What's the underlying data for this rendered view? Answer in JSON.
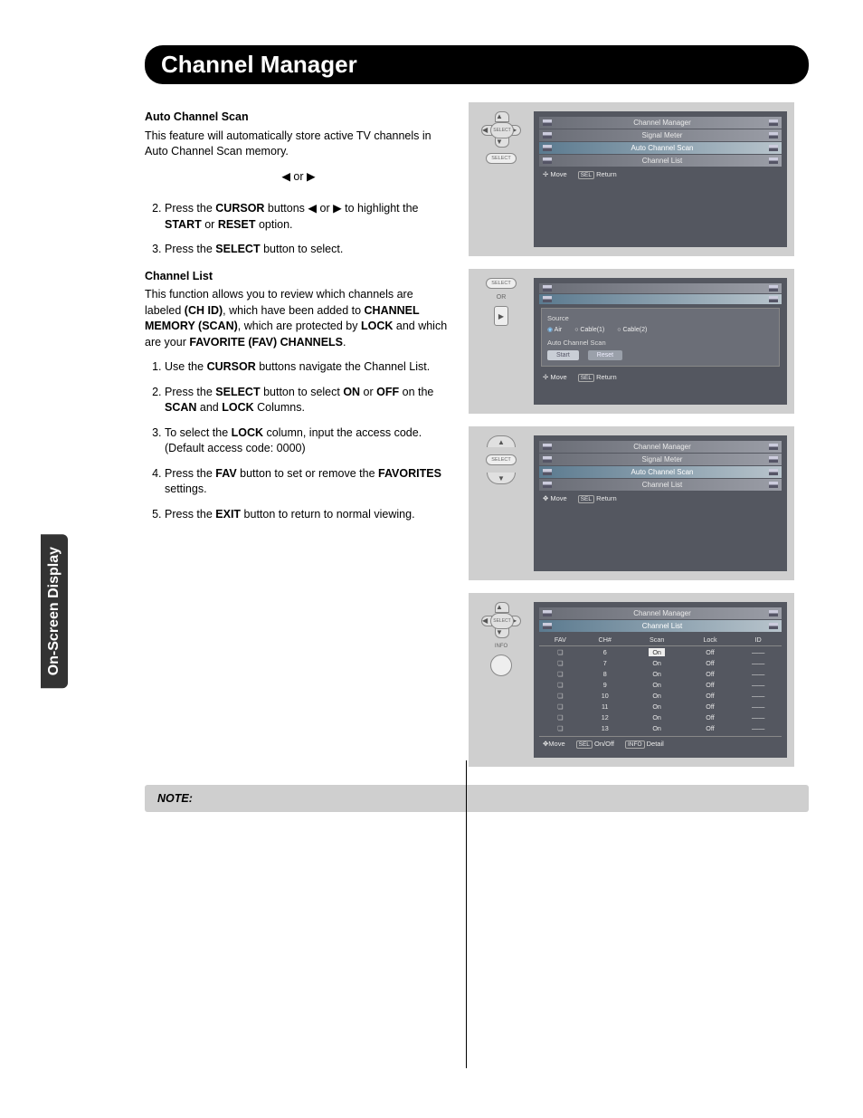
{
  "sideTab": "On-Screen Display",
  "title": "Channel Manager",
  "acs": {
    "heading": "Auto Channel Scan",
    "intro": "This feature will automatically store active TV channels in Auto Channel Scan memory.",
    "orLine": "◀ or ▶",
    "step2_a": "Press the ",
    "step2_b": "CURSOR",
    "step2_c": " buttons ◀ or ▶ to highlight the ",
    "step2_d": "START",
    "step2_e": " or ",
    "step2_f": "RESET",
    "step2_g": " option.",
    "step3_a": "Press the ",
    "step3_b": "SELECT",
    "step3_c": " button to select."
  },
  "cl": {
    "heading": "Channel List",
    "p1_a": "This function allows you to review which channels are labeled ",
    "p1_b": "(CH ID)",
    "p1_c": ", which have been added to ",
    "p1_d": "CHANNEL MEMORY (SCAN)",
    "p1_e": ", which are protected by ",
    "p1_f": "LOCK",
    "p1_g": " and which are your ",
    "p1_h": "FAVORITE (FAV) CHANNELS",
    "p1_i": ".",
    "s1_a": "Use the ",
    "s1_b": "CURSOR",
    "s1_c": " buttons navigate the Channel List.",
    "s2_a": "Press the ",
    "s2_b": "SELECT",
    "s2_c": " button to select ",
    "s2_d": "ON",
    "s2_e": " or ",
    "s2_f": "OFF",
    "s2_g": " on the ",
    "s2_h": "SCAN",
    "s2_i": " and ",
    "s2_j": "LOCK",
    "s2_k": " Columns.",
    "s3_a": "To select the ",
    "s3_b": "LOCK",
    "s3_c": " column, input the access code. (Default access code: 0000)",
    "s4_a": "Press the ",
    "s4_b": "FAV",
    "s4_c": " button to set or remove the ",
    "s4_d": "FAVORITES",
    "s4_e": " settings.",
    "s5_a": "Press the ",
    "s5_b": "EXIT",
    "s5_c": " button to return to normal viewing."
  },
  "note": "NOTE:",
  "osd": {
    "cm": "Channel Manager",
    "sm": "Signal Meter",
    "acs": "Auto Channel Scan",
    "cl": "Channel List",
    "move": "Move",
    "ret": "Return",
    "sel": "SEL",
    "src": "Source",
    "air": "Air",
    "c1": "Cable(1)",
    "c2": "Cable(2)",
    "start": "Start",
    "reset": "Reset",
    "or": "OR",
    "info": "INFO",
    "select": "SELECT",
    "onoff": "On/Off",
    "detail": "Detail",
    "infoK": "INFO"
  },
  "table": {
    "h_fav": "FAV",
    "h_ch": "CH#",
    "h_scan": "Scan",
    "h_lock": "Lock",
    "h_id": "ID",
    "rows": [
      {
        "ch": "6",
        "scan": "On",
        "lock": "Off",
        "id": "——"
      },
      {
        "ch": "7",
        "scan": "On",
        "lock": "Off",
        "id": "——"
      },
      {
        "ch": "8",
        "scan": "On",
        "lock": "Off",
        "id": "——"
      },
      {
        "ch": "9",
        "scan": "On",
        "lock": "Off",
        "id": "——"
      },
      {
        "ch": "10",
        "scan": "On",
        "lock": "Off",
        "id": "——"
      },
      {
        "ch": "11",
        "scan": "On",
        "lock": "Off",
        "id": "——"
      },
      {
        "ch": "12",
        "scan": "On",
        "lock": "Off",
        "id": "——"
      },
      {
        "ch": "13",
        "scan": "On",
        "lock": "Off",
        "id": "——"
      }
    ]
  }
}
